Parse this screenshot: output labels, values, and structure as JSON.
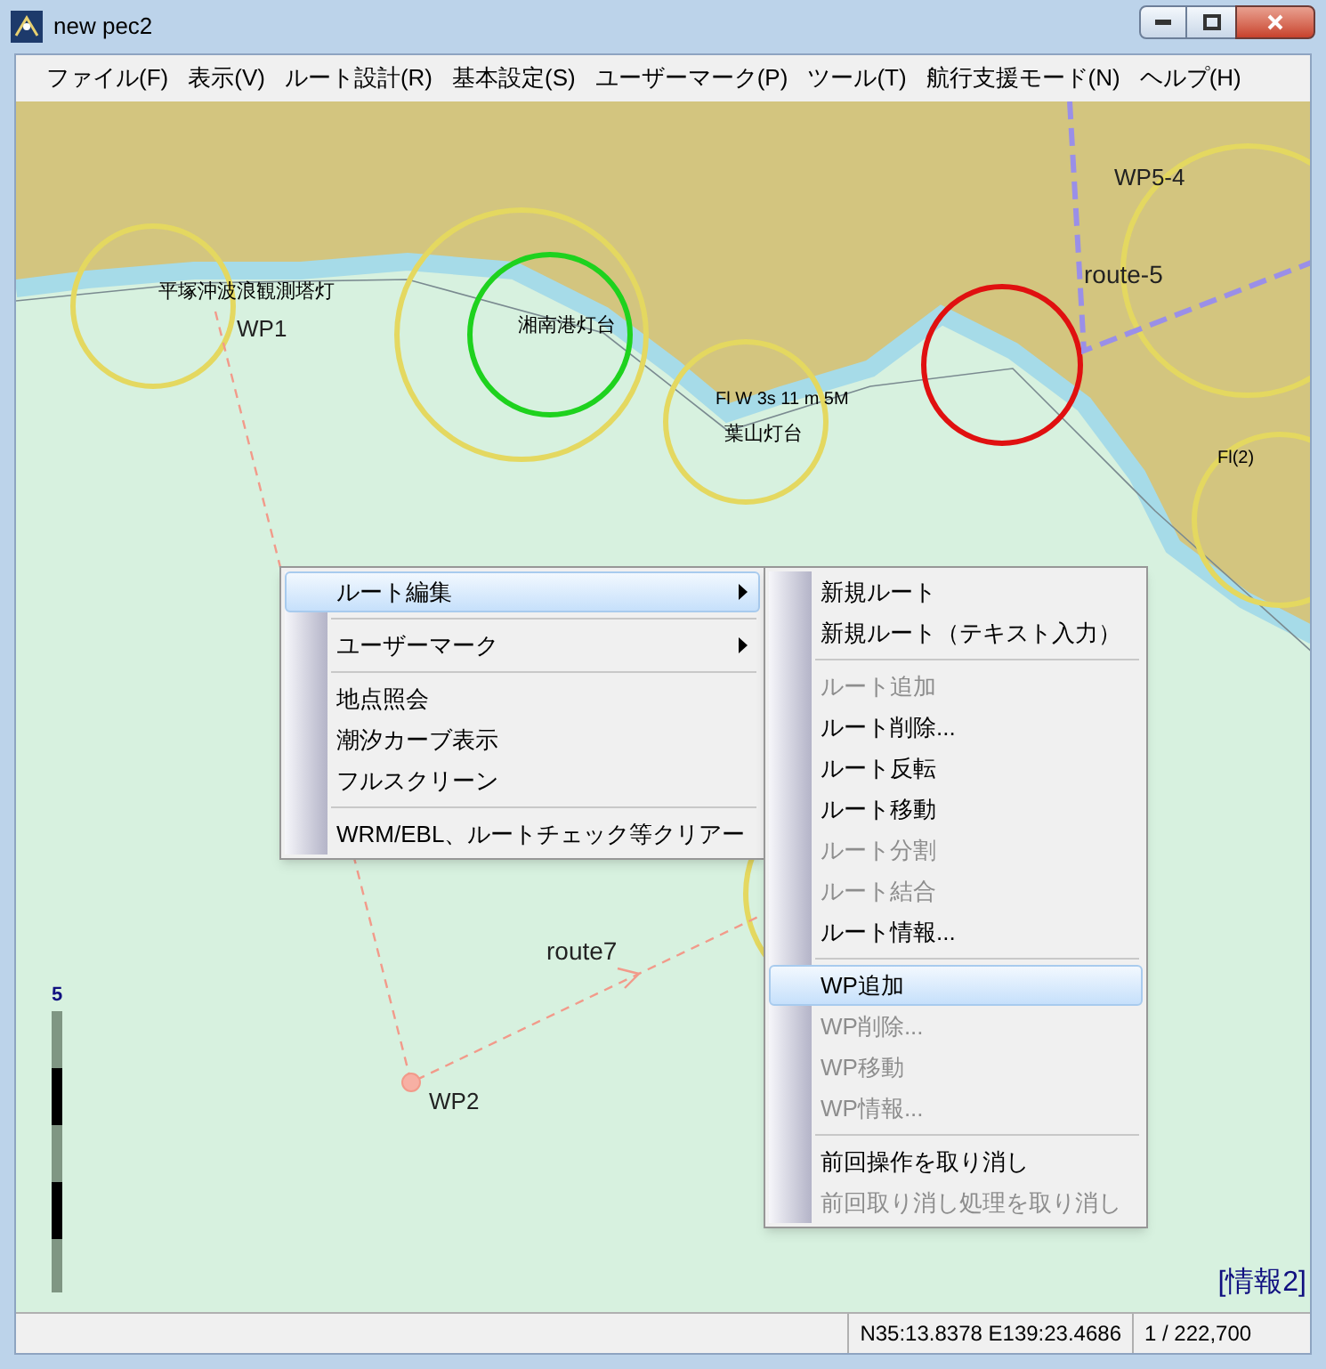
{
  "window": {
    "title": "new pec2"
  },
  "menu_bar": [
    "ファイル(F)",
    "表示(V)",
    "ルート設計(R)",
    "基本設定(S)",
    "ユーザーマーク(P)",
    "ツール(T)",
    "航行支援モード(N)",
    "ヘルプ(H)"
  ],
  "map": {
    "labels": [
      {
        "kind": "name",
        "text": "平塚沖波浪観測塔灯"
      },
      {
        "kind": "waypoint",
        "text": "WP1"
      },
      {
        "kind": "name",
        "text": "湘南港灯台"
      },
      {
        "kind": "light",
        "text": "Fl W 3s 11 m 5M"
      },
      {
        "kind": "name",
        "text": "葉山灯台"
      },
      {
        "kind": "route",
        "text": "route-5"
      },
      {
        "kind": "waypoint",
        "text": "WP5-4"
      },
      {
        "kind": "light",
        "text": "Fl(2)"
      },
      {
        "kind": "route",
        "text": "route7"
      },
      {
        "kind": "waypoint",
        "text": "WP2"
      }
    ],
    "scale_label": "5",
    "info_label": "[情報2]"
  },
  "context_menu": [
    {
      "kind": "item",
      "label": "ルート編集",
      "selected": true,
      "disabled": false,
      "submenu": true
    },
    {
      "kind": "separator"
    },
    {
      "kind": "item",
      "label": "ユーザーマーク",
      "selected": false,
      "disabled": false,
      "submenu": true
    },
    {
      "kind": "separator"
    },
    {
      "kind": "item",
      "label": "地点照会",
      "selected": false,
      "disabled": false,
      "submenu": false
    },
    {
      "kind": "item",
      "label": "潮汐カーブ表示",
      "selected": false,
      "disabled": false,
      "submenu": false
    },
    {
      "kind": "item",
      "label": "フルスクリーン",
      "selected": false,
      "disabled": false,
      "submenu": false
    },
    {
      "kind": "separator"
    },
    {
      "kind": "item",
      "label": "WRM/EBL、ルートチェック等クリアー",
      "selected": false,
      "disabled": false,
      "submenu": false
    }
  ],
  "submenu": [
    {
      "kind": "item",
      "label": "新規ルート",
      "selected": false,
      "disabled": false
    },
    {
      "kind": "item",
      "label": "新規ルート（テキスト入力）",
      "selected": false,
      "disabled": false
    },
    {
      "kind": "separator"
    },
    {
      "kind": "item",
      "label": "ルート追加",
      "selected": false,
      "disabled": true
    },
    {
      "kind": "item",
      "label": "ルート削除...",
      "selected": false,
      "disabled": false
    },
    {
      "kind": "item",
      "label": "ルート反転",
      "selected": false,
      "disabled": false
    },
    {
      "kind": "item",
      "label": "ルート移動",
      "selected": false,
      "disabled": false
    },
    {
      "kind": "item",
      "label": "ルート分割",
      "selected": false,
      "disabled": true
    },
    {
      "kind": "item",
      "label": "ルート結合",
      "selected": false,
      "disabled": true
    },
    {
      "kind": "item",
      "label": "ルート情報...",
      "selected": false,
      "disabled": false
    },
    {
      "kind": "separator"
    },
    {
      "kind": "item",
      "label": "WP追加",
      "selected": true,
      "disabled": false
    },
    {
      "kind": "item",
      "label": "WP削除...",
      "selected": false,
      "disabled": true
    },
    {
      "kind": "item",
      "label": "WP移動",
      "selected": false,
      "disabled": true
    },
    {
      "kind": "item",
      "label": "WP情報...",
      "selected": false,
      "disabled": true
    },
    {
      "kind": "separator"
    },
    {
      "kind": "item",
      "label": "前回操作を取り消し",
      "selected": false,
      "disabled": false
    },
    {
      "kind": "item",
      "label": "前回取り消し処理を取り消し",
      "selected": false,
      "disabled": true
    }
  ],
  "status_bar": {
    "coordinates": "N35:13.8378 E139:23.4686",
    "scale": "1 / 222,700"
  }
}
